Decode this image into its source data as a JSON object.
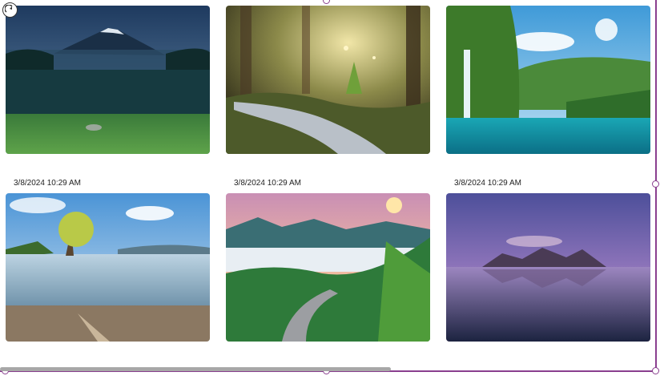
{
  "gallery": {
    "items": [
      {
        "label": "Volcano night valley",
        "date": ""
      },
      {
        "label": "Forest stream",
        "date": ""
      },
      {
        "label": "Waterfall lagoon",
        "date": ""
      },
      {
        "label": "Lake tree",
        "date": "3/8/2024 10:29 AM"
      },
      {
        "label": "Mountain road clouds",
        "date": "3/8/2024 10:29 AM"
      },
      {
        "label": "Beach mountain sunset",
        "date": "3/8/2024 10:29 AM"
      }
    ]
  },
  "selection": {
    "accent": "#8a3f8f"
  },
  "scrollbar": {
    "position_fraction": 0.0,
    "visible_fraction": 0.59
  }
}
